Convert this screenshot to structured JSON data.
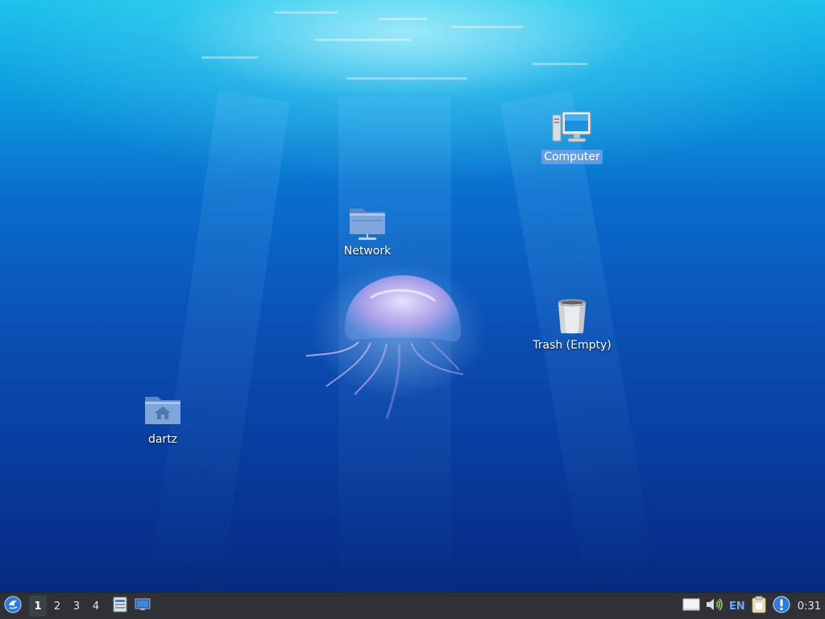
{
  "desktop": {
    "icons": [
      {
        "label": "Computer",
        "icon": "computer-icon",
        "selected": true
      },
      {
        "label": "Network",
        "icon": "network-folder-icon"
      },
      {
        "label": "Trash (Empty)",
        "icon": "trash-icon"
      },
      {
        "label": "dartz",
        "icon": "home-folder-icon"
      }
    ]
  },
  "taskbar": {
    "start_icon": "menu-logo-icon",
    "workspaces": [
      "1",
      "2",
      "3",
      "4"
    ],
    "active_workspace": "1",
    "launchers": [
      "file-manager-icon",
      "show-desktop-icon"
    ],
    "tray": {
      "items": [
        "window-icon",
        "volume-icon",
        "clipboard-icon",
        "update-notifier-icon"
      ],
      "language": "EN",
      "clock": "0:31"
    }
  },
  "colors": {
    "taskbar_bg": "#2f3136",
    "active_workspace_bg": "#3c4047",
    "lang_accent": "#6aa9ff",
    "selection": "#6ea0e6"
  }
}
